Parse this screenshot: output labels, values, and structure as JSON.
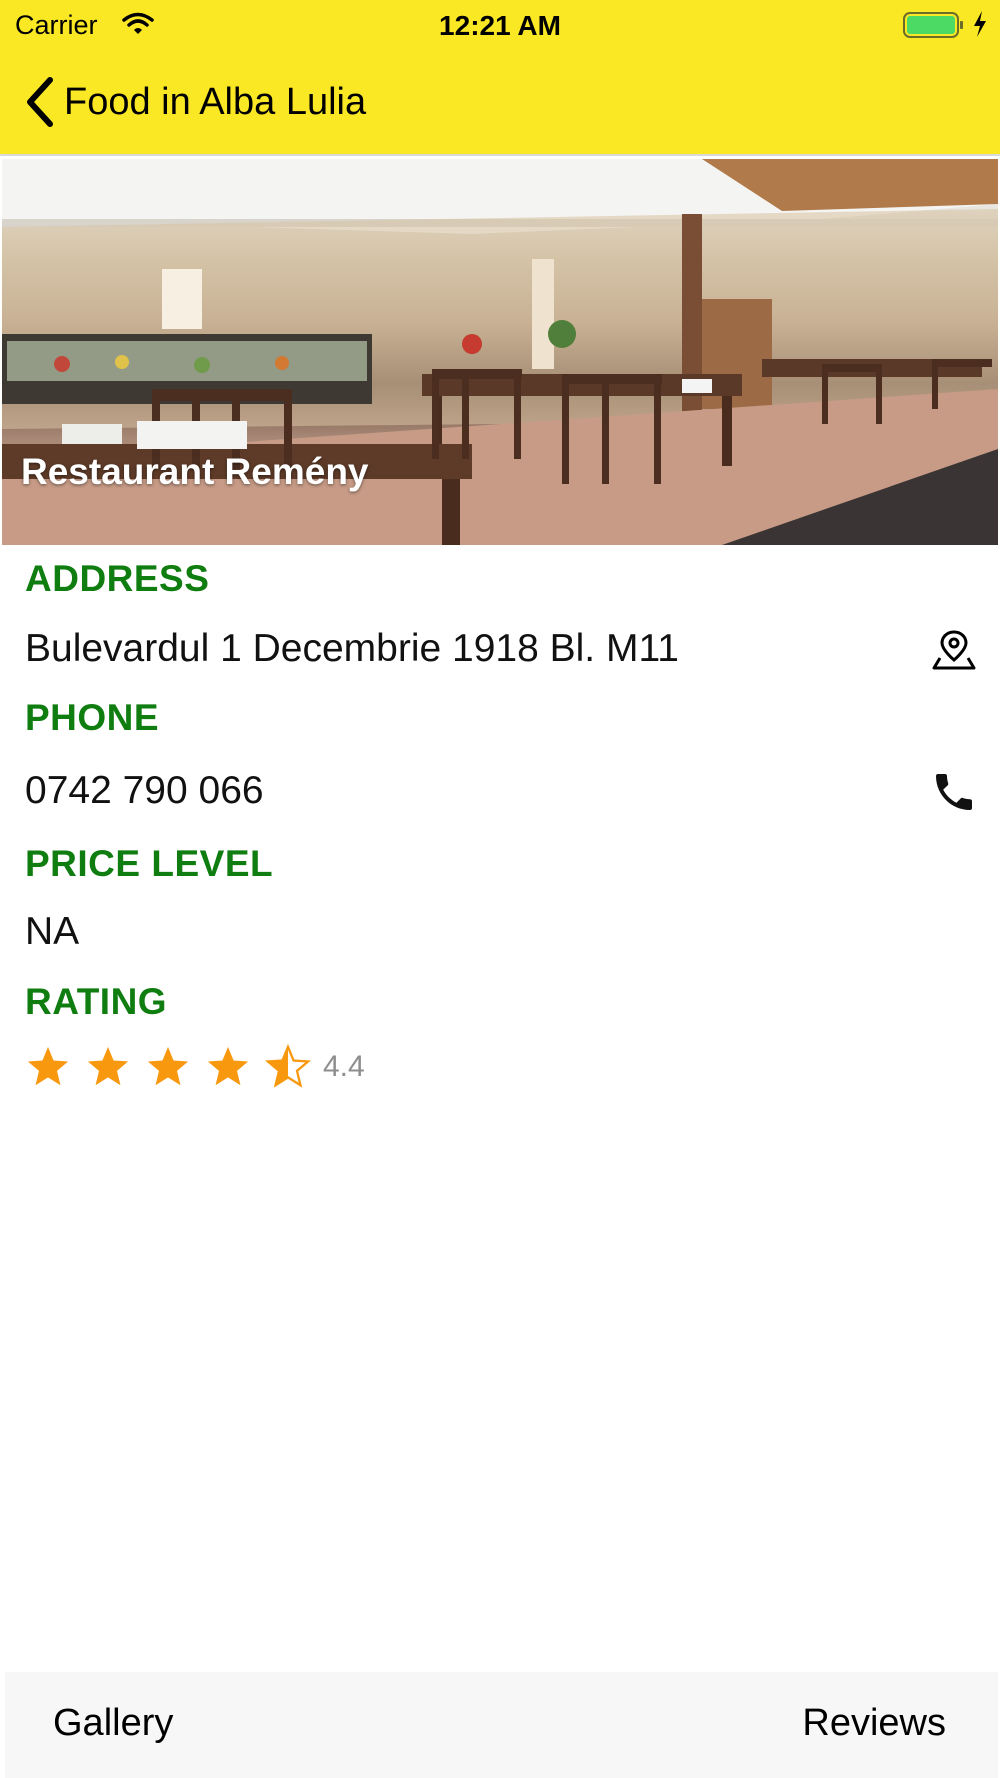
{
  "status_bar": {
    "carrier": "Carrier",
    "time": "12:21 AM"
  },
  "nav": {
    "back_title": "Food in Alba Lulia"
  },
  "restaurant": {
    "name": "Restaurant Remény",
    "address_label": "ADDRESS",
    "address": "Bulevardul 1 Decembrie 1918 Bl. M11",
    "phone_label": "PHONE",
    "phone": "0742 790 066",
    "price_label": "PRICE LEVEL",
    "price_level": "NA",
    "rating_label": "RATING",
    "rating": 4.4,
    "rating_text": "4.4",
    "rating_max": 5
  },
  "tabs": {
    "gallery": "Gallery",
    "reviews": "Reviews"
  },
  "colors": {
    "bar_yellow": "#fbe824",
    "label_green": "#0f7d0f",
    "star_orange": "#f7980f"
  },
  "icons": [
    "wifi-icon",
    "battery-icon",
    "charge-icon",
    "back-chevron-icon",
    "map-pin-icon",
    "phone-icon",
    "star-icon"
  ]
}
